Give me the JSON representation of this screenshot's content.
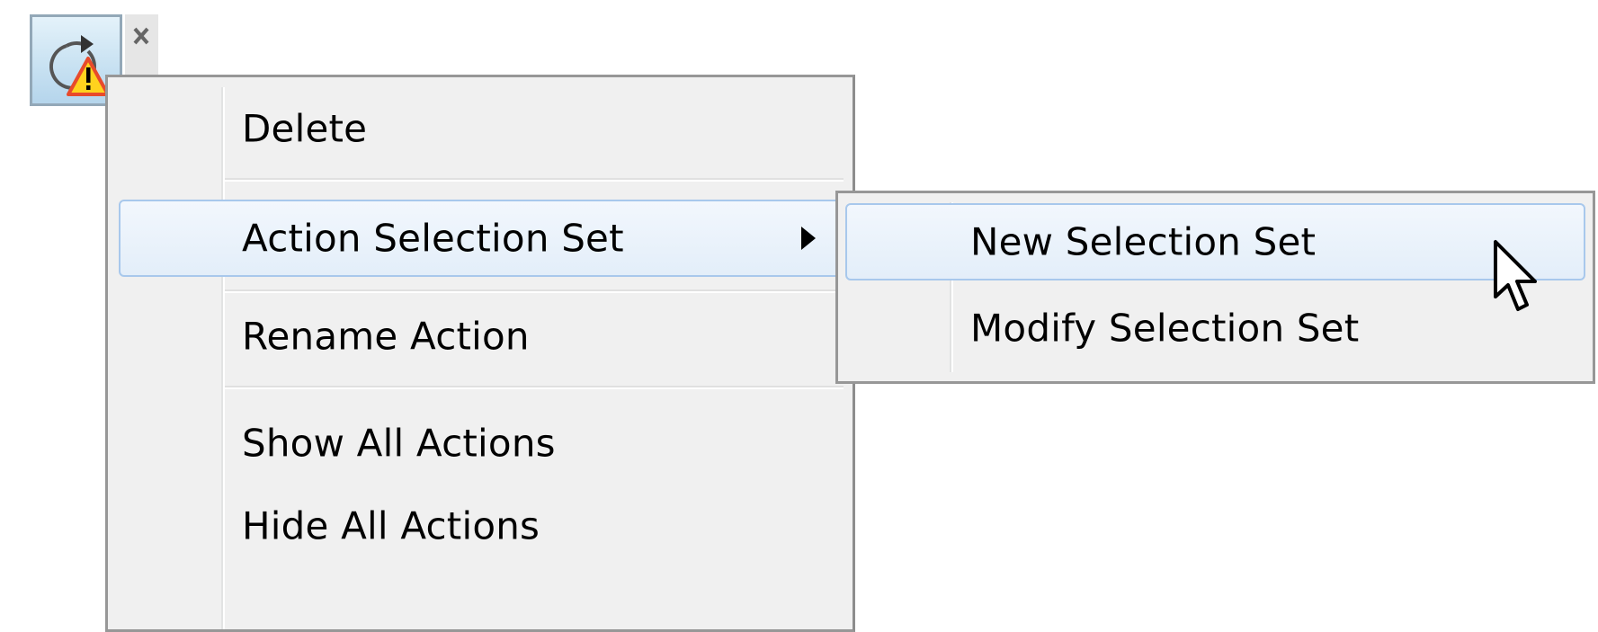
{
  "toolbar": {
    "action_icon": "rotate-warning-icon",
    "close_icon": "close-icon"
  },
  "context_menu": {
    "items": [
      {
        "label": "Delete"
      },
      {
        "label": "Action Selection Set",
        "has_submenu": true,
        "highlighted": true
      },
      {
        "label": "Rename Action"
      },
      {
        "label": "Show All Actions"
      },
      {
        "label": "Hide All Actions"
      }
    ]
  },
  "submenu": {
    "items": [
      {
        "label": "New Selection Set",
        "highlighted": true
      },
      {
        "label": "Modify Selection Set"
      }
    ]
  },
  "colors": {
    "menu_background": "#f0f0f0",
    "menu_border": "#979797",
    "highlight_border": "#a8c8ec",
    "warning_yellow": "#ffd21e",
    "warning_red": "#e84a2b"
  }
}
